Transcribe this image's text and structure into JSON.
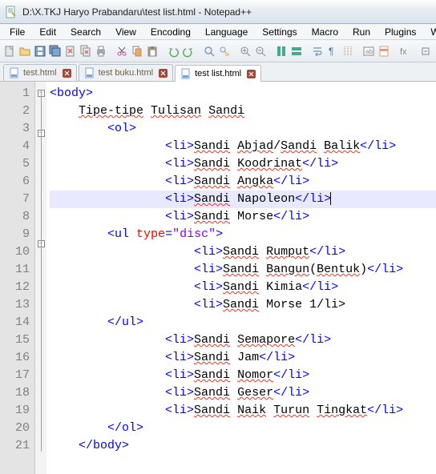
{
  "window": {
    "title": "D:\\X.TKJ Haryo Prabandaru\\test list.html - Notepad++"
  },
  "menu": [
    "File",
    "Edit",
    "Search",
    "View",
    "Encoding",
    "Language",
    "Settings",
    "Macro",
    "Run",
    "Plugins",
    "Window",
    "?"
  ],
  "tabs": [
    {
      "label": "test.html",
      "active": false
    },
    {
      "label": "test buku.html",
      "active": false
    },
    {
      "label": "test list.html",
      "active": true
    }
  ],
  "code_lines": [
    {
      "n": 1,
      "fold": "box-minus",
      "indent": "",
      "parts": [
        [
          "tag",
          "<body>"
        ]
      ]
    },
    {
      "n": 2,
      "indent": "    ",
      "parts": [
        [
          "squig",
          "Tipe-tipe"
        ],
        [
          "txt",
          " "
        ],
        [
          "squig",
          "Tulisan"
        ],
        [
          "txt",
          " "
        ],
        [
          "squig",
          "Sandi"
        ]
      ]
    },
    {
      "n": 3,
      "fold": "box-minus",
      "indent": "        ",
      "parts": [
        [
          "tag",
          "<ol>"
        ]
      ]
    },
    {
      "n": 4,
      "indent": "                ",
      "parts": [
        [
          "tag",
          "<li>"
        ],
        [
          "squig",
          "Sandi"
        ],
        [
          "txt",
          " "
        ],
        [
          "squig",
          "Abjad"
        ],
        [
          "txt",
          "/"
        ],
        [
          "squig",
          "Sandi"
        ],
        [
          "txt",
          " "
        ],
        [
          "squig",
          "Balik"
        ],
        [
          "tag",
          "</li>"
        ]
      ]
    },
    {
      "n": 5,
      "indent": "                ",
      "parts": [
        [
          "tag",
          "<li>"
        ],
        [
          "squig",
          "Sandi"
        ],
        [
          "txt",
          " "
        ],
        [
          "squig",
          "Koodrinat"
        ],
        [
          "tag",
          "</li>"
        ]
      ]
    },
    {
      "n": 6,
      "indent": "                ",
      "parts": [
        [
          "tag",
          "<li>"
        ],
        [
          "squig",
          "Sandi"
        ],
        [
          "txt",
          " "
        ],
        [
          "squig",
          "Angka"
        ],
        [
          "tag",
          "</li>"
        ]
      ]
    },
    {
      "n": 7,
      "hl": true,
      "cursor": true,
      "indent": "                ",
      "parts": [
        [
          "tag",
          "<li>"
        ],
        [
          "squig",
          "Sandi"
        ],
        [
          "txt",
          " Napoleon"
        ],
        [
          "tag",
          "</li>"
        ]
      ]
    },
    {
      "n": 8,
      "indent": "                ",
      "parts": [
        [
          "tag",
          "<li>"
        ],
        [
          "squig",
          "Sandi"
        ],
        [
          "txt",
          " Morse"
        ],
        [
          "tag",
          "</li>"
        ]
      ]
    },
    {
      "n": 9,
      "fold": "box-minus",
      "indent": "        ",
      "parts": [
        [
          "tag",
          "<ul"
        ],
        [
          "txt",
          " "
        ],
        [
          "attr",
          "type"
        ],
        [
          "tag",
          "="
        ],
        [
          "val",
          "\"disc\""
        ],
        [
          "tag",
          ">"
        ]
      ]
    },
    {
      "n": 10,
      "indent": "                    ",
      "parts": [
        [
          "tag",
          "<li>"
        ],
        [
          "squig",
          "Sandi"
        ],
        [
          "txt",
          " "
        ],
        [
          "squig",
          "Rumput"
        ],
        [
          "tag",
          "</li>"
        ]
      ]
    },
    {
      "n": 11,
      "indent": "                    ",
      "parts": [
        [
          "tag",
          "<li>"
        ],
        [
          "squig",
          "Sandi"
        ],
        [
          "txt",
          " "
        ],
        [
          "squig",
          "Bangun"
        ],
        [
          "txt",
          "("
        ],
        [
          "squig",
          "Bentuk"
        ],
        [
          "txt",
          ")"
        ],
        [
          "tag",
          "</li>"
        ]
      ]
    },
    {
      "n": 12,
      "indent": "                    ",
      "parts": [
        [
          "tag",
          "<li>"
        ],
        [
          "squig",
          "Sandi"
        ],
        [
          "txt",
          " Kimia"
        ],
        [
          "tag",
          "</li>"
        ]
      ]
    },
    {
      "n": 13,
      "indent": "                    ",
      "parts": [
        [
          "tag",
          "<li>"
        ],
        [
          "squig",
          "Sandi"
        ],
        [
          "txt",
          " Morse 1/li>"
        ]
      ]
    },
    {
      "n": 14,
      "indent": "        ",
      "parts": [
        [
          "tag",
          "</ul>"
        ]
      ]
    },
    {
      "n": 15,
      "indent": "                ",
      "parts": [
        [
          "tag",
          "<li>"
        ],
        [
          "squig",
          "Sandi"
        ],
        [
          "txt",
          " "
        ],
        [
          "squig",
          "Semapore"
        ],
        [
          "tag",
          "</li>"
        ]
      ]
    },
    {
      "n": 16,
      "indent": "                ",
      "parts": [
        [
          "tag",
          "<li>"
        ],
        [
          "squig",
          "Sandi"
        ],
        [
          "txt",
          " Jam"
        ],
        [
          "tag",
          "</li>"
        ]
      ]
    },
    {
      "n": 17,
      "indent": "                ",
      "parts": [
        [
          "tag",
          "<li>"
        ],
        [
          "squig",
          "Sandi"
        ],
        [
          "txt",
          " "
        ],
        [
          "squig",
          "Nomor"
        ],
        [
          "tag",
          "</li>"
        ]
      ]
    },
    {
      "n": 18,
      "indent": "                ",
      "parts": [
        [
          "tag",
          "<li>"
        ],
        [
          "squig",
          "Sandi"
        ],
        [
          "txt",
          " "
        ],
        [
          "squig",
          "Geser"
        ],
        [
          "tag",
          "</li>"
        ]
      ]
    },
    {
      "n": 19,
      "indent": "                ",
      "parts": [
        [
          "tag",
          "<li>"
        ],
        [
          "squig",
          "Sandi"
        ],
        [
          "txt",
          " "
        ],
        [
          "squig",
          "Naik"
        ],
        [
          "txt",
          " "
        ],
        [
          "squig",
          "Turun"
        ],
        [
          "txt",
          " "
        ],
        [
          "squig",
          "Tingkat"
        ],
        [
          "tag",
          "</li>"
        ]
      ]
    },
    {
      "n": 20,
      "indent": "        ",
      "parts": [
        [
          "tag",
          "</ol>"
        ]
      ]
    },
    {
      "n": 21,
      "indent": "    ",
      "parts": [
        [
          "tag",
          "</body>"
        ]
      ]
    }
  ],
  "toolbar_icons": [
    {
      "name": "new-file",
      "c": "#e4e7ea",
      "shape": "doc"
    },
    {
      "name": "open-file",
      "c": "#f3d48a",
      "shape": "folder"
    },
    {
      "name": "save-file",
      "c": "#7aa6d6",
      "shape": "disk"
    },
    {
      "name": "save-all",
      "c": "#7aa6d6",
      "shape": "disks"
    },
    {
      "name": "close-file",
      "c": "#d66",
      "shape": "docx"
    },
    {
      "name": "close-all",
      "c": "#d66",
      "shape": "docsx"
    },
    {
      "name": "print",
      "c": "#aab",
      "shape": "printer"
    },
    {
      "sep": true
    },
    {
      "name": "cut",
      "c": "#d4a",
      "shape": "scissors"
    },
    {
      "name": "copy",
      "c": "#ea5",
      "shape": "copy"
    },
    {
      "name": "paste",
      "c": "#c96",
      "shape": "paste"
    },
    {
      "sep": true
    },
    {
      "name": "undo",
      "c": "#6a6",
      "shape": "undo"
    },
    {
      "name": "redo",
      "c": "#6a6",
      "shape": "redo"
    },
    {
      "sep": true
    },
    {
      "name": "find",
      "c": "#89b",
      "shape": "search"
    },
    {
      "name": "replace",
      "c": "#89b",
      "shape": "replace"
    },
    {
      "sep": true
    },
    {
      "name": "zoom-in",
      "c": "#888",
      "shape": "zin"
    },
    {
      "name": "zoom-out",
      "c": "#888",
      "shape": "zout"
    },
    {
      "sep": true
    },
    {
      "name": "sync-v",
      "c": "#4a8",
      "shape": "syncv"
    },
    {
      "name": "sync-h",
      "c": "#4a8",
      "shape": "synch"
    },
    {
      "sep": true
    },
    {
      "name": "wrap",
      "c": "#579",
      "shape": "wrap"
    },
    {
      "name": "all-chars",
      "c": "#579",
      "shape": "para"
    },
    {
      "name": "indent-guide",
      "c": "#a86",
      "shape": "guide"
    },
    {
      "sep": true
    },
    {
      "name": "lang",
      "c": "#888",
      "shape": "lang"
    },
    {
      "name": "doc-map",
      "c": "#e96",
      "shape": "dmap"
    },
    {
      "sep": true
    },
    {
      "name": "fn-list",
      "c": "#888",
      "shape": "fn"
    },
    {
      "sep": true
    },
    {
      "name": "fold-all",
      "c": "#888",
      "shape": "fall"
    },
    {
      "name": "unfold-all",
      "c": "#888",
      "shape": "ufall"
    },
    {
      "sep": true
    },
    {
      "name": "macro-rec",
      "c": "#c44",
      "shape": "rec"
    }
  ]
}
